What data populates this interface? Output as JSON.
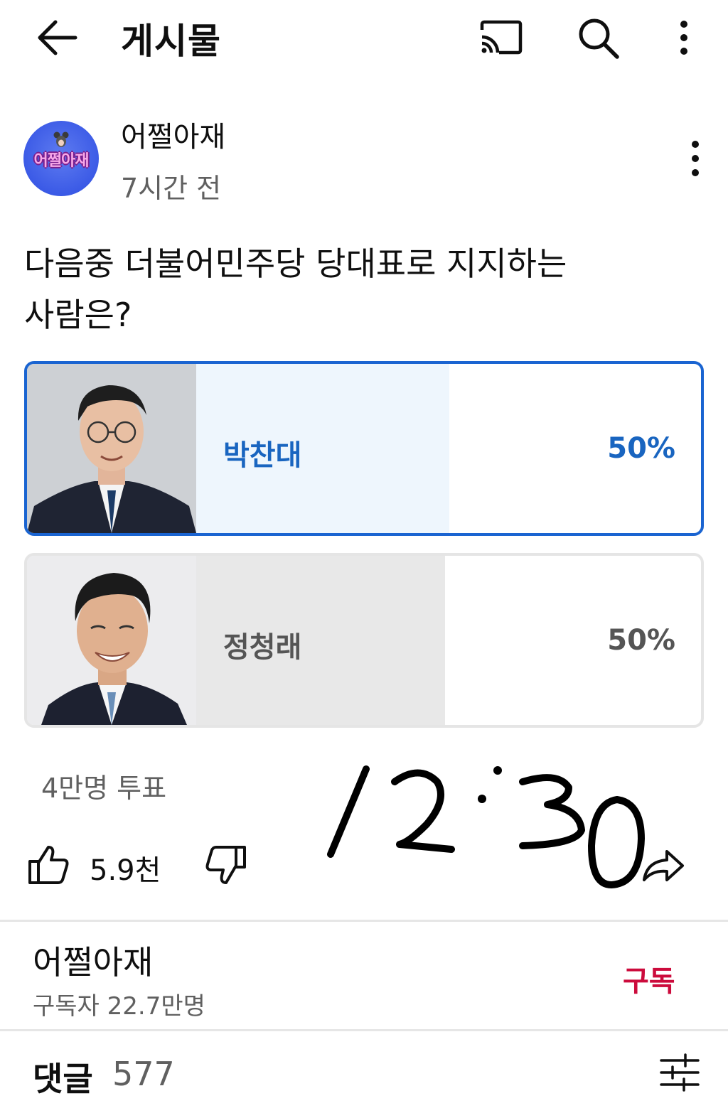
{
  "topbar": {
    "title": "게시물"
  },
  "post": {
    "author": "어쩔아재",
    "avatar_text": "어쩔아재",
    "time": "7시간 전",
    "question_line1": "다음중 더불어민주당 당대표로 지지하는",
    "question_line2": "사람은?"
  },
  "poll": {
    "options": [
      {
        "label": "박찬대",
        "percent": "50%",
        "selected": true
      },
      {
        "label": "정청래",
        "percent": "50%",
        "selected": false
      }
    ],
    "vote_count": "4만명 투표"
  },
  "handwriting": "12:30",
  "actions": {
    "like_count": "5.9천"
  },
  "channel": {
    "name": "어쩔아재",
    "subscribers": "구독자 22.7만명",
    "subscribe_label": "구독"
  },
  "comments": {
    "label": "댓글",
    "count": "577"
  },
  "colors": {
    "accent": "#1965c0",
    "subscribe": "#cc0b3c",
    "selected_fill": "#eef6fd",
    "unselected_fill": "#e8e8e8"
  },
  "icons": [
    "back-arrow-icon",
    "cast-icon",
    "search-icon",
    "more-vert-icon",
    "thumbs-up-icon",
    "thumbs-down-icon",
    "share-icon",
    "filter-icon"
  ]
}
